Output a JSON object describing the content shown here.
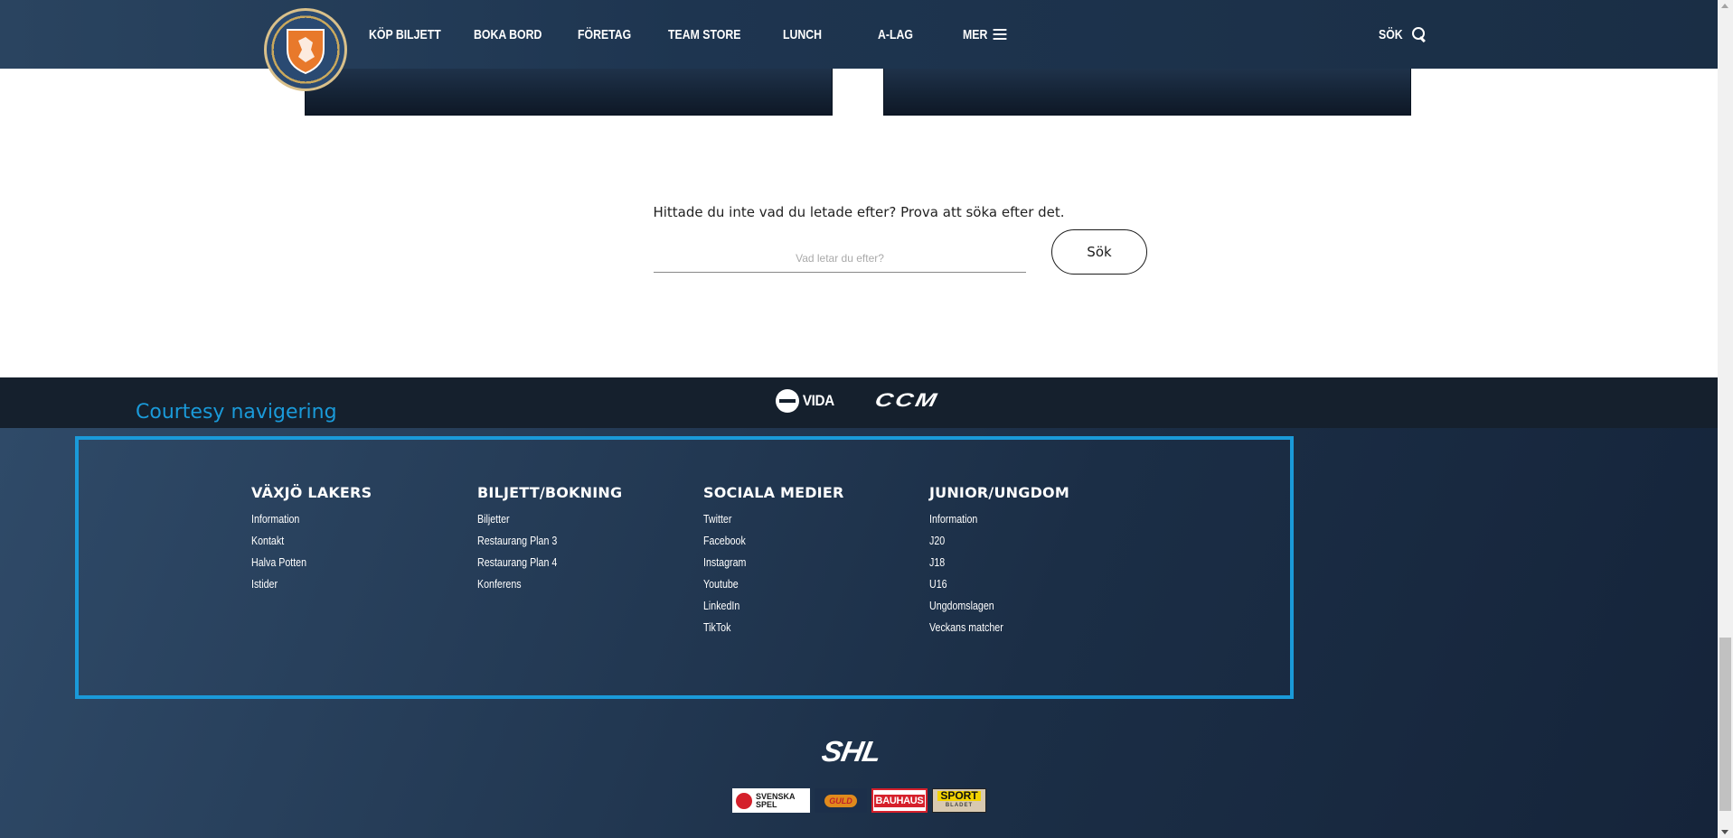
{
  "header": {
    "nav": {
      "buy_ticket": "KÖP BILJETT",
      "book_table": "BOKA BORD",
      "company": "FÖRETAG",
      "team_store": "TEAM STORE",
      "lunch": "LUNCH",
      "a_team": "A-LAG",
      "more": "MER"
    },
    "search_label": "SÖK",
    "logo_icon": "vaxjo-lakers-crest-icon"
  },
  "search_section": {
    "prompt": "Hittade du inte vad du letade efter? Prova att söka efter det.",
    "placeholder": "Vad letar du efter?",
    "value": "",
    "button_label": "Sök"
  },
  "sponsors_top": {
    "vida": "VIDA",
    "ccm": "CCM"
  },
  "footer": {
    "courtesy_label": "Courtesy navigering",
    "columns": [
      {
        "title": "VÄXJÖ LAKERS",
        "links": [
          "Information",
          "Kontakt",
          "Halva Potten",
          "Istider"
        ]
      },
      {
        "title": "BILJETT/BOKNING",
        "links": [
          "Biljetter",
          "Restaurang Plan 3",
          "Restaurang Plan 4",
          "Konferens"
        ]
      },
      {
        "title": "SOCIALA MEDIER",
        "links": [
          "Twitter",
          "Facebook",
          "Instagram",
          "Youtube",
          "LinkedIn",
          "TikTok"
        ]
      },
      {
        "title": "JUNIOR/UNGDOM",
        "links": [
          "Information",
          "J20",
          "J18",
          "U16",
          "Ungdomslagen",
          "Veckans matcher"
        ]
      }
    ],
    "league_logo": "SHL",
    "partners": {
      "svenska_spel_line1": "SVENSKA",
      "svenska_spel_line2": "SPEL",
      "guld": "GULD",
      "bauhaus": "BAUHAUS",
      "sport": "SPORT",
      "sport_sub": "BLADET"
    }
  },
  "colors": {
    "header_bg": "#1e3550",
    "footer_bg": "#1b2e46",
    "highlight": "#1a9ad9"
  }
}
